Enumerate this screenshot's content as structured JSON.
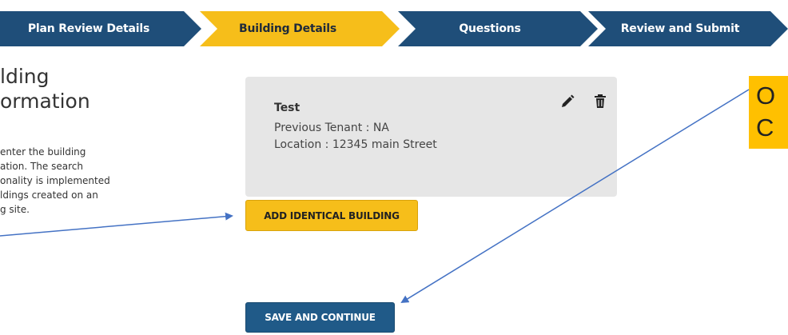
{
  "stepper": {
    "steps": [
      {
        "label": "Plan Review Details",
        "state": "done"
      },
      {
        "label": "Building Details",
        "state": "active"
      },
      {
        "label": "Questions",
        "state": "pending"
      },
      {
        "label": "Review and Submit",
        "state": "pending"
      }
    ]
  },
  "left": {
    "title_line1": "lding",
    "title_line2": "ormation",
    "desc_line1": "enter the building",
    "desc_line2": "ation. The search",
    "desc_line3": "onality is implemented",
    "desc_line4": "ldings created on an",
    "desc_line5": "g site."
  },
  "card": {
    "name": "Test",
    "previous_tenant": "Previous Tenant : NA",
    "location": "Location : 12345 main Street",
    "edit_icon": "pencil-icon",
    "delete_icon": "trash-icon"
  },
  "buttons": {
    "add_identical": "ADD IDENTICAL BUILDING",
    "save_continue": "SAVE AND CONTINUE"
  },
  "annotation": {
    "line1": "O",
    "line2": "C"
  },
  "colors": {
    "navy": "#1f4e79",
    "gold": "#f6be1a",
    "callout": "#ffc000",
    "arrow": "#4472c4"
  }
}
